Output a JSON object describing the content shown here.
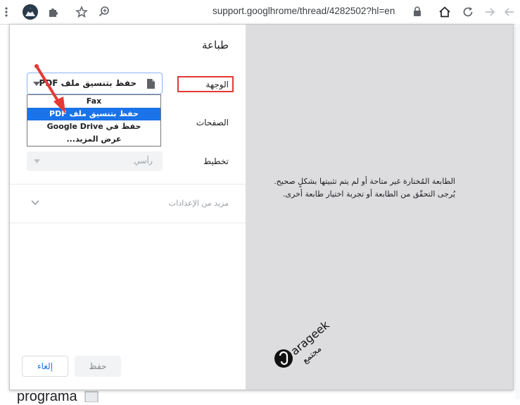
{
  "browser": {
    "url": "support.googlhrome/thread/4282502?hl=en"
  },
  "dialog": {
    "title": "طباعة",
    "destination_label": "الوجهة",
    "destination_value": "حفظ بتنسيق ملف PDF",
    "pages_label": "الصفحات",
    "layout_label": "تخطيط",
    "layout_value": "رأسي",
    "more_settings": "مزيد من الإعدادات",
    "save_button": "حفظ",
    "cancel_button": "إلغاء",
    "dropdown_options": [
      "Fax",
      "حفظ بتنسيق ملف PDF",
      "حفظ في Google Drive",
      "عرض المزيد..."
    ],
    "preview_message_line1": "الطابعة المُختارة غير متاحة أو لم يتم تثبيتها بشكلٍ صحيح.",
    "preview_message_line2": "يُرجى التحقّق من الطابعة أو تجربة اختيار طابعة أخرى.",
    "watermark_text": "arageek",
    "watermark_sub": "مجتمع"
  },
  "page_behind": {
    "text": "programa"
  },
  "colors": {
    "highlight_red": "#e53935",
    "selected_blue": "#1a73e8",
    "preview_bg": "#dddde0"
  }
}
